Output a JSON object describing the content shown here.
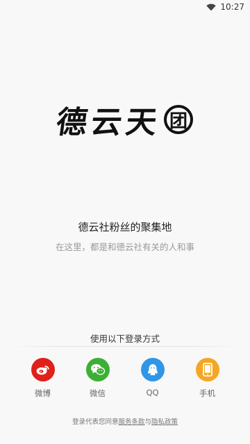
{
  "status_bar": {
    "time": "10:27",
    "wifi_icon": "wifi-icon"
  },
  "logo": {
    "chars": [
      "德",
      "云",
      "天"
    ],
    "circle_char": "团"
  },
  "tagline": "德云社粉丝的聚集地",
  "subline": "在这里，都是和德云社有关的人和事",
  "login": {
    "header": "使用以下登录方式",
    "options": [
      {
        "label": "微博",
        "icon": "weibo-icon",
        "color": "#e0201b"
      },
      {
        "label": "微信",
        "icon": "wechat-icon",
        "color": "#3cb034"
      },
      {
        "label": "QQ",
        "icon": "qq-icon",
        "color": "#2f96e8"
      },
      {
        "label": "手机",
        "icon": "phone-icon",
        "color": "#f5a623"
      }
    ]
  },
  "agreement": {
    "prefix": "登录代表您同意",
    "terms": "服务条款",
    "and": "与",
    "privacy": "隐私政策"
  }
}
